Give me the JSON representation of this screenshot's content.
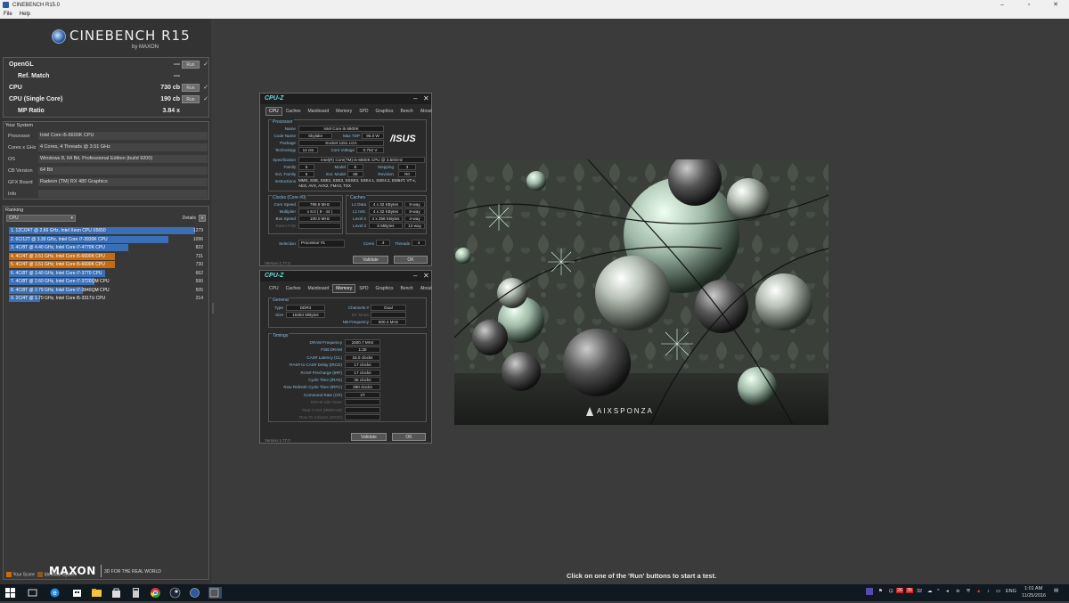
{
  "titlebar": {
    "title": "CINEBENCH R15.0",
    "min": "–",
    "max": "▫",
    "close": "✕"
  },
  "menu": [
    "File",
    "Help"
  ],
  "logo": {
    "name": "CINEBENCH R15",
    "by": "by MAXON"
  },
  "scores": [
    {
      "label": "OpenGL",
      "value": "---",
      "run": "Run",
      "check": "✓"
    },
    {
      "label": "Ref. Match",
      "value": "---",
      "run": "",
      "check": ""
    },
    {
      "label": "CPU",
      "value": "730 cb",
      "run": "Run",
      "check": "✓"
    },
    {
      "label": "CPU (Single Core)",
      "value": "190 cb",
      "run": "Run",
      "check": "✓"
    },
    {
      "label": "MP Ratio",
      "value": "3.84 x",
      "run": "",
      "check": ""
    }
  ],
  "system": {
    "title": "Your System",
    "rows": [
      {
        "k": "Processor",
        "v": "Intel Core i5-6600K CPU"
      },
      {
        "k": "Cores x GHz",
        "v": "4 Cores, 4 Threads @ 3.51 GHz"
      },
      {
        "k": "OS",
        "v": "Windows 8, 64 Bit, Professional Edition (build 9200)"
      },
      {
        "k": "CB Version",
        "v": "64 Bit"
      },
      {
        "k": "GFX Board",
        "v": "Radeon (TM) RX 480 Graphics"
      },
      {
        "k": "Info",
        "v": ""
      }
    ]
  },
  "ranking": {
    "title": "Ranking",
    "select": "CPU",
    "details": "Details",
    "items": [
      {
        "label": "1. 12C/24T @ 2.66 GHz, Intel Xeon CPU X5650",
        "value": "1279",
        "fraction": 1.0,
        "color": "#3a6fb5"
      },
      {
        "label": "2. 6C/12T @ 3.30 GHz, Intel Core i7-3930K CPU",
        "value": "1096",
        "fraction": 0.857,
        "color": "#3a6fb5"
      },
      {
        "label": "3. 4C/8T @ 4.40 GHz, Intel Core i7-4770K CPU",
        "value": "822",
        "fraction": 0.643,
        "color": "#3a6fb5"
      },
      {
        "label": "4. 4C/4T @ 3.51 GHz, Intel Core i5-6600K CPU",
        "value": "731",
        "fraction": 0.571,
        "color": "#c86a10"
      },
      {
        "label": "5. 4C/4T @ 3.51 GHz, Intel Core i5-6600K CPU",
        "value": "730",
        "fraction": 0.571,
        "color": "#c86a10"
      },
      {
        "label": "6. 4C/8T @ 3.40 GHz, Intel Core i7-3770 CPU",
        "value": "662",
        "fraction": 0.518,
        "color": "#3a6fb5"
      },
      {
        "label": "7. 4C/8T @ 2.60 GHz, Intel Core i7-3720QM CPU",
        "value": "590",
        "fraction": 0.461,
        "color": "#3a6fb5"
      },
      {
        "label": "8. 4C/8T @ 2.79 GHz, Intel Core i7-3840QM CPU",
        "value": "505",
        "fraction": 0.395,
        "color": "#3a6fb5"
      },
      {
        "label": "9. 2C/4T @ 1.70 GHz, Intel Core i5-3317U CPU",
        "value": "214",
        "fraction": 0.167,
        "color": "#3a6fb5"
      }
    ],
    "legend_your": "Your Score",
    "legend_identical": "Identical System"
  },
  "maxon": {
    "brand": "MAXON",
    "tag": "3D FOR THE REAL WORLD"
  },
  "status": "Click on one of the 'Run' buttons to start a test.",
  "cpuz1": {
    "title": "CPU-Z",
    "tabs": [
      "CPU",
      "Caches",
      "Mainboard",
      "Memory",
      "SPD",
      "Graphics",
      "Bench",
      "About"
    ],
    "processor_label": "Processor",
    "name_k": "Name",
    "name_v": "Intel Core i5 6600K",
    "code_k": "Code Name",
    "code_v": "Skylake",
    "tdp_k": "Max TDP",
    "tdp_v": "95.0 W",
    "pkg_k": "Package",
    "pkg_v": "Socket 1151 LGA",
    "tech_k": "Technology",
    "tech_v": "14 nm",
    "volt_k": "Core Voltage",
    "volt_v": "0.752 V",
    "spec_k": "Specification",
    "spec_v": "Intel(R) Core(TM) i5-6600K CPU @ 3.50GHz",
    "fam_k": "Family",
    "fam_v": "6",
    "mod_k": "Model",
    "mod_v": "E",
    "step_k": "Stepping",
    "step_v": "3",
    "efam_k": "Ext. Family",
    "efam_v": "6",
    "emod_k": "Ext. Model",
    "emod_v": "5E",
    "rev_k": "Revision",
    "rev_v": "R0",
    "instr_k": "Instructions",
    "instr_v": "MMX, SSE, SSE2, SSE3, SSSE3, SSE4.1, SSE4.2, EM64T, VT-x, AES, AVX, AVX2, FMA3, TSX",
    "logo": "/ISUS",
    "clocks_label": "Clocks (Core #0)",
    "cs_k": "Core Speed",
    "cs_v": "799.8 MHz",
    "mul_k": "Multiplier",
    "mul_v": "x 8.0 ( 8 - 44 )",
    "bus_k": "Bus Speed",
    "bus_v": "100.0 MHz",
    "fsb_k": "Rated FSB",
    "fsb_v": "",
    "caches_label": "Caches",
    "l1d_k": "L1 Data",
    "l1d_v": "4 x 32 KBytes",
    "l1d_w": "8-way",
    "l1i_k": "L1 Inst.",
    "l1i_v": "4 x 32 KBytes",
    "l1i_w": "8-way",
    "l2_k": "Level 2",
    "l2_v": "4 x 256 KBytes",
    "l2_w": "4-way",
    "l3_k": "Level 3",
    "l3_v": "6 MBytes",
    "l3_w": "12-way",
    "sel_k": "Selection",
    "sel_v": "Processor #1",
    "cores_k": "Cores",
    "cores_v": "4",
    "thr_k": "Threads",
    "thr_v": "4",
    "version": "Version 1.77.0",
    "validate": "Validate",
    "ok": "OK"
  },
  "cpuz2": {
    "title": "CPU-Z",
    "tabs": [
      "CPU",
      "Caches",
      "Mainboard",
      "Memory",
      "SPD",
      "Graphics",
      "Bench",
      "About"
    ],
    "general_label": "General",
    "type_k": "Type",
    "type_v": "DDR4",
    "ch_k": "Channels #",
    "ch_v": "Dual",
    "size_k": "Size",
    "size_v": "16384 MBytes",
    "dc_k": "DC Mode",
    "dc_v": "",
    "nb_k": "NB Frequency",
    "nb_v": "800.4 MHz",
    "timings_label": "Timings",
    "timings": [
      {
        "k": "DRAM Frequency",
        "v": "1500.7 MHz"
      },
      {
        "k": "FSB:DRAM",
        "v": "1:30"
      },
      {
        "k": "CAS# Latency (CL)",
        "v": "15.0 clocks"
      },
      {
        "k": "RAS# to CAS# Delay (tRCD)",
        "v": "17 clocks"
      },
      {
        "k": "RAS# Precharge (tRP)",
        "v": "17 clocks"
      },
      {
        "k": "Cycle Time (tRAS)",
        "v": "35 clocks"
      },
      {
        "k": "Row Refresh Cycle Time (tRFC)",
        "v": "390 clocks"
      },
      {
        "k": "Command Rate (CR)",
        "v": "2T"
      },
      {
        "k": "DRAM Idle Timer",
        "v": ""
      },
      {
        "k": "Total CAS# (tRDRAM)",
        "v": ""
      },
      {
        "k": "Row To Column (tRCD)",
        "v": ""
      }
    ],
    "version": "Version 1.77.0",
    "validate": "Validate",
    "ok": "OK"
  },
  "render": {
    "watermark": "AIXSPONZA"
  },
  "taskbar": {
    "icons": [
      "windows-start-icon",
      "search-icon",
      "task-view-icon",
      "edge-icon",
      "explorer-icon",
      "store-icon",
      "calculator-icon",
      "chrome-icon",
      "steam-icon",
      "cinebench-icon",
      "cpuz-icon"
    ],
    "tray_badges": [
      "26",
      "35",
      "32"
    ],
    "lang": "ENG",
    "time": "1:01 AM",
    "date": "11/25/2016"
  }
}
